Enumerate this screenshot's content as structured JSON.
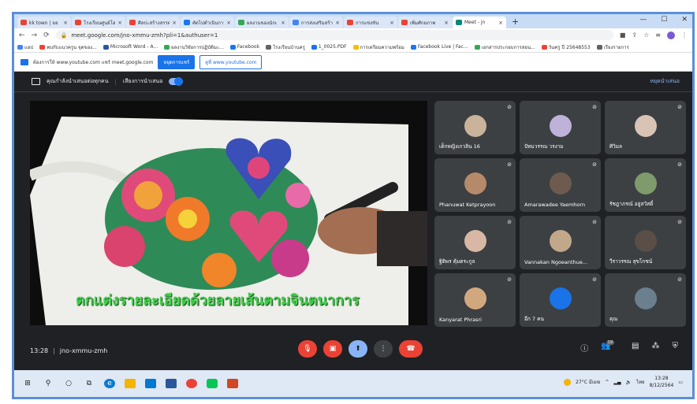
{
  "browser": {
    "tabs": [
      {
        "label": "kk town | ยอ",
        "color": "#ea4335",
        "active": false
      },
      {
        "label": "โรงเรียนศูนย์โฮ",
        "color": "#ea4335",
        "active": false
      },
      {
        "label": "ศิลปะสร้างสรรค์",
        "color": "#ea4335",
        "active": false
      },
      {
        "label": "คัดไปดำเนินการ",
        "color": "#1877f2",
        "active": false
      },
      {
        "label": "ผลงานของนักเ",
        "color": "#34a853",
        "active": false
      },
      {
        "label": "การส่งเสริมสร้าง",
        "color": "#4285f4",
        "active": false
      },
      {
        "label": "การแข่งขัน",
        "color": "#ea4335",
        "active": false
      },
      {
        "label": "เพิ่มศักยภาพ",
        "color": "#ea4335",
        "active": false
      },
      {
        "label": "Meet - jn",
        "color": "#00897b",
        "active": true
      }
    ],
    "new_tab": "+",
    "url": "meet.google.com/jno-xmmu-zmh?pli=1&authuser=1",
    "bookmarks": [
      {
        "label": "แอป",
        "color": "#4285f4"
      },
      {
        "label": "พบกับแนวครูน จุดของ...",
        "color": "#ea4335"
      },
      {
        "label": "Microsoft Word - A...",
        "color": "#2b579a"
      },
      {
        "label": "ผลงานวิจัยการปฏิบัติมะ...",
        "color": "#34a853"
      },
      {
        "label": "Facebook",
        "color": "#1877f2"
      },
      {
        "label": "โรงเรียนบ้านครู",
        "color": "#5f6368"
      },
      {
        "label": "1_0025.PDF",
        "color": "#1a73e8"
      },
      {
        "label": "การเตรียมความพร้อม",
        "color": "#fbbc04"
      },
      {
        "label": "Facebook Live | Fac...",
        "color": "#1877f2"
      },
      {
        "label": "เอกสารประกอบการสอน...",
        "color": "#34a853"
      },
      {
        "label": "วันครู ปี 25648553",
        "color": "#ea4335"
      },
      {
        "label": "เรียงรายการ",
        "color": "#5f6368"
      }
    ],
    "notification": {
      "message": "ต้องการให้ www.youtube.com แชร์ meet.google.com",
      "primary_button": "หยุดการแชร์",
      "secondary_button": "ดูที่ www.youtube.com"
    }
  },
  "meet": {
    "presenting_text": "คุณกำลังนำเสนอต่อทุกคน",
    "audio_label": "เสียงการนำเสนอ",
    "stop_presenting": "หยุดนำเสนอ",
    "caption": "ตกแต่งรายละเอียดด้วยลายเส้นตามจินตนาการ",
    "participants": [
      {
        "name": "เด็กหญิงเกวลิน 16",
        "avatar": "#c9b39a"
      },
      {
        "name": "ปัทมวรรณ วรงาม",
        "avatar": "#bfb2d9"
      },
      {
        "name": "ศิวิมล",
        "avatar": "#d8c3b5"
      },
      {
        "name": "Phanuwat Ketprayoon",
        "avatar": "#b58a6a"
      },
      {
        "name": "Amarawadee Yaemhorn",
        "avatar": "#6d5b4f"
      },
      {
        "name": "รัชฎาภรณ์ อยู่สวัสดิ์",
        "avatar": "#7f9a6c"
      },
      {
        "name": "ฐิติพร คุ้มตระกูล",
        "avatar": "#d9b7a5"
      },
      {
        "name": "Vannakan Ngoeanthue...",
        "avatar": "#c2a88a"
      },
      {
        "name": "วีราวรรณ สุขโกชน์",
        "avatar": "#5a4e46"
      },
      {
        "name": "Kanyarat Phrasri",
        "avatar": "#d1a87e"
      },
      {
        "name": "อีก 7 คน",
        "avatar": "#1a73e8"
      },
      {
        "name": "คุณ",
        "avatar": "#6b7f8f"
      }
    ],
    "time": "13:28",
    "meeting_code": "jno-xmmu-zmh",
    "participant_count": "19"
  },
  "taskbar": {
    "weather": "27°C มีเมฆ",
    "time": "13:28",
    "date": "8/12/2564",
    "language": "ไทย"
  }
}
